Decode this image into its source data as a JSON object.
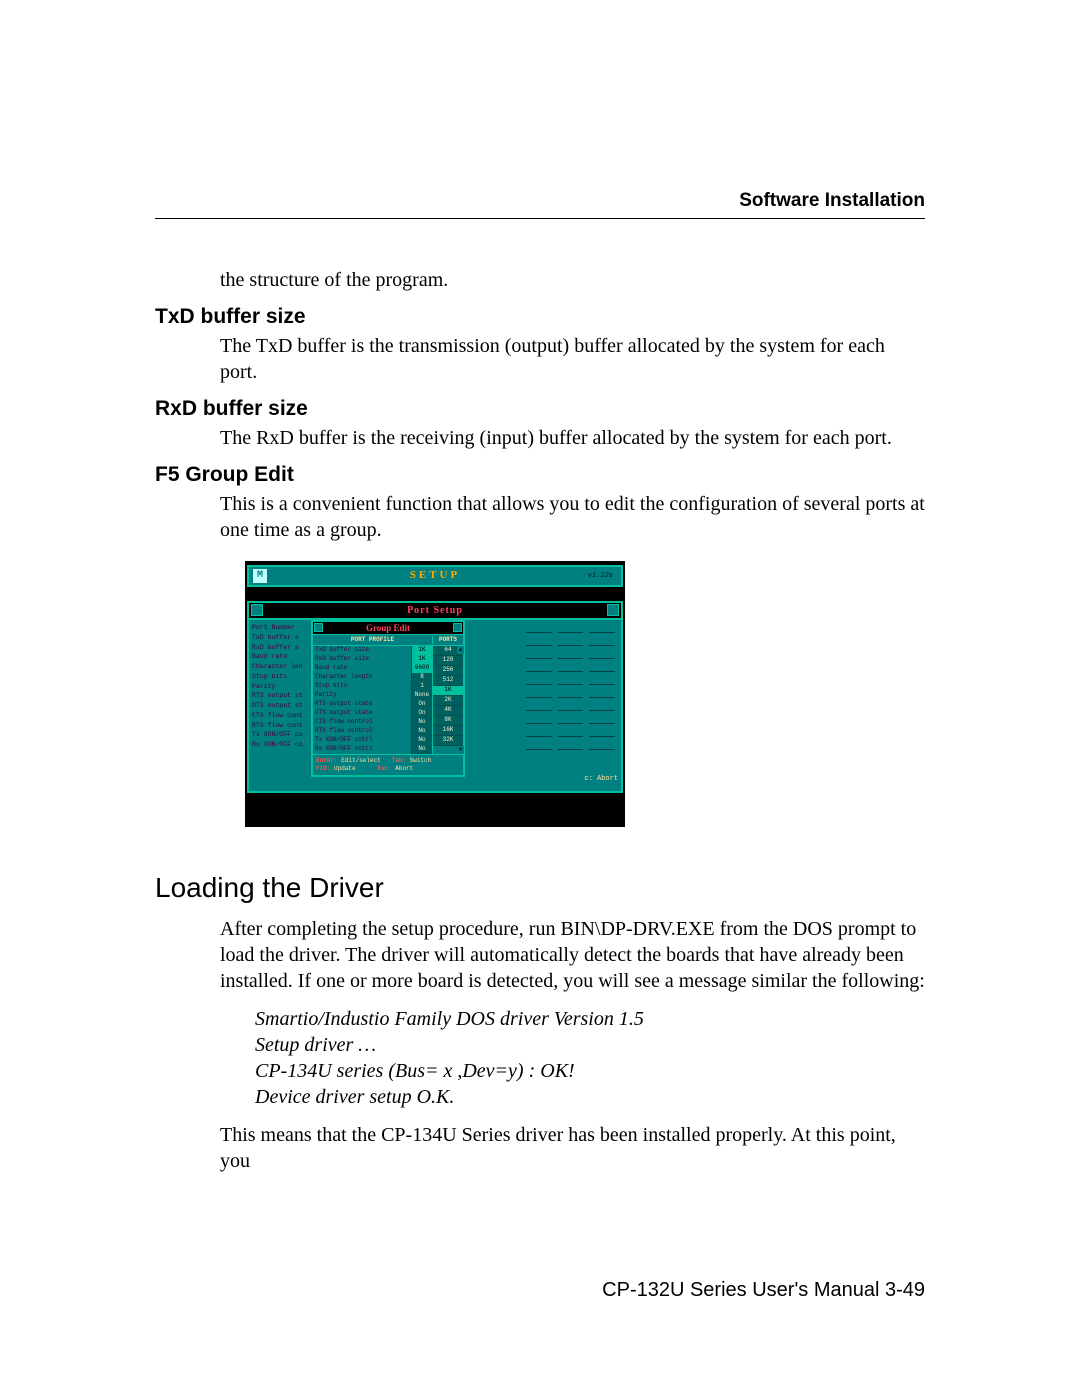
{
  "header": "Software Installation",
  "intro_line": "the structure of the program.",
  "sections": {
    "txd": {
      "heading": "TxD buffer size",
      "body": "The TxD buffer is the transmission (output) buffer allocated by the system for each port."
    },
    "rxd": {
      "heading": "RxD buffer size",
      "body": "The RxD buffer is the receiving (input) buffer allocated by the system for each port."
    },
    "f5": {
      "heading": "F5 Group Edit",
      "body": "This is a convenient function that allows you to edit the configuration of several ports at one time as a group."
    }
  },
  "loading": {
    "heading": "Loading the Driver",
    "body1": "After completing the setup procedure, run BIN\\DP-DRV.EXE from the DOS prompt to load the driver. The driver will automatically detect the boards that have already been installed. If one or more board is detected, you will see a message similar the following:",
    "italic": {
      "l1": "Smartio/Industio Family DOS driver Version 1.5",
      "l2": "Setup driver …",
      "l3": "CP-134U series (Bus= x ,Dev=y) : OK!",
      "l4": "Device driver setup O.K."
    },
    "body2": "This means that the CP-134U Series driver has been installed properly. At this point, you"
  },
  "footer": "CP-132U Series User's Manual 3-49",
  "dos": {
    "logo": "M",
    "setup": "SETUP",
    "version": "v1.22a",
    "port_setup": "Port Setup",
    "group_edit": "Group Edit",
    "port_profile": "PORT PROFILE",
    "ports_hdr": "PORTS",
    "left_labels": [
      "Port Number",
      "TxD buffer s",
      "RxD buffer s",
      "Baud rate",
      "Character len",
      "Stop bits",
      "Parity",
      "RTS output st",
      "DTS output st",
      "CTS flow cont",
      "RTS flow cont",
      "Tx XON/OFF co",
      "Rx XON/OFF co"
    ],
    "profile_rows": [
      {
        "label": "TxD buffer size",
        "val": "1K"
      },
      {
        "label": "RxD buffer size",
        "val": "1K"
      },
      {
        "label": "Baud rate",
        "val": "9600"
      },
      {
        "label": "Character length",
        "val": "8"
      },
      {
        "label": "Stop bits",
        "val": "1"
      },
      {
        "label": "Parity",
        "val": "None"
      },
      {
        "label": "RTS output state",
        "val": "On"
      },
      {
        "label": "DTS output state",
        "val": "On"
      },
      {
        "label": "CTS flow control",
        "val": "No"
      },
      {
        "label": "RTS flow control",
        "val": "No"
      },
      {
        "label": "Tx XON/OFF cntrl",
        "val": "No"
      },
      {
        "label": "Rx XON/OFF cntrl",
        "val": "No"
      }
    ],
    "port_values": [
      "64",
      "128",
      "256",
      "512",
      "1K",
      "2K",
      "4K",
      "8K",
      "16K",
      "32K"
    ],
    "hints": {
      "enter": "Enter:",
      "enter_t": "Edit/select",
      "tab": "Tab:",
      "tab_t": "Switch",
      "f10": "F10:",
      "f10_t": "Update",
      "esc": "Esc:",
      "esc_t": "Abort"
    },
    "abort": "c: Abort"
  }
}
